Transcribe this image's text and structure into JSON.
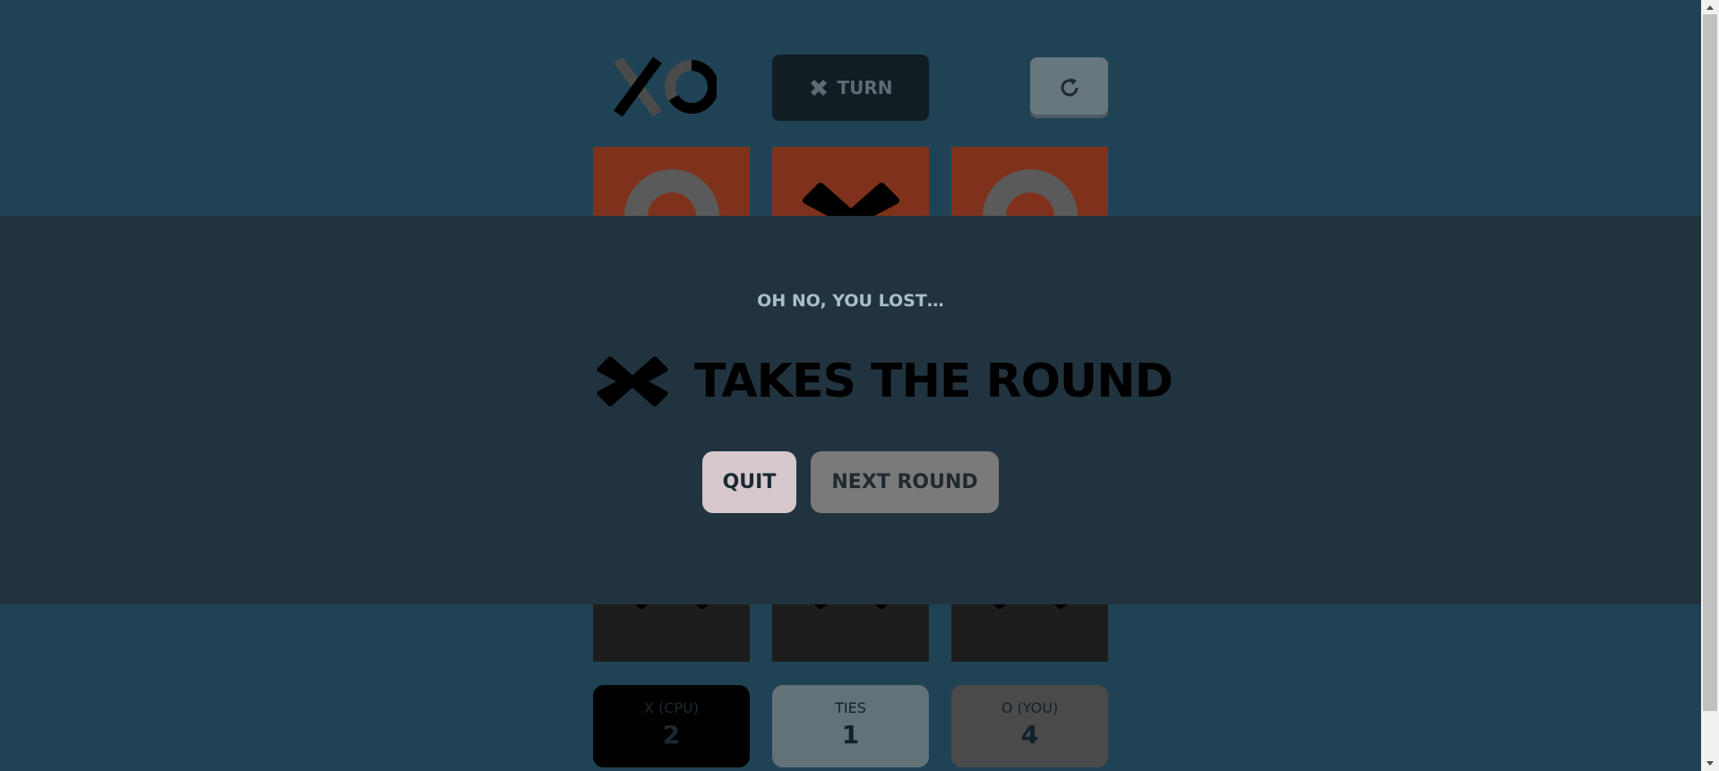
{
  "header": {
    "turn_label": "TURN",
    "turn_icon": "x-icon",
    "restart_icon": "restart-icon"
  },
  "board": {
    "cells": [
      "O",
      "X",
      "O",
      "",
      "",
      "",
      "X",
      "X",
      "X"
    ],
    "colors": {
      "top_row_bg": "#7f321b",
      "bottom_row_bg": "#1d1d1d",
      "o_mark": "#5a5a5a",
      "x_mark": "#000000"
    }
  },
  "scores": {
    "x_label": "X (CPU)",
    "x_value": "2",
    "ties_label": "TIES",
    "ties_value": "1",
    "o_label": "O (YOU)",
    "o_value": "4"
  },
  "modal": {
    "subtitle": "OH NO, YOU LOST…",
    "winner_icon": "x-icon",
    "title": "TAKES THE ROUND",
    "quit_label": "QUIT",
    "next_label": "NEXT ROUND"
  }
}
